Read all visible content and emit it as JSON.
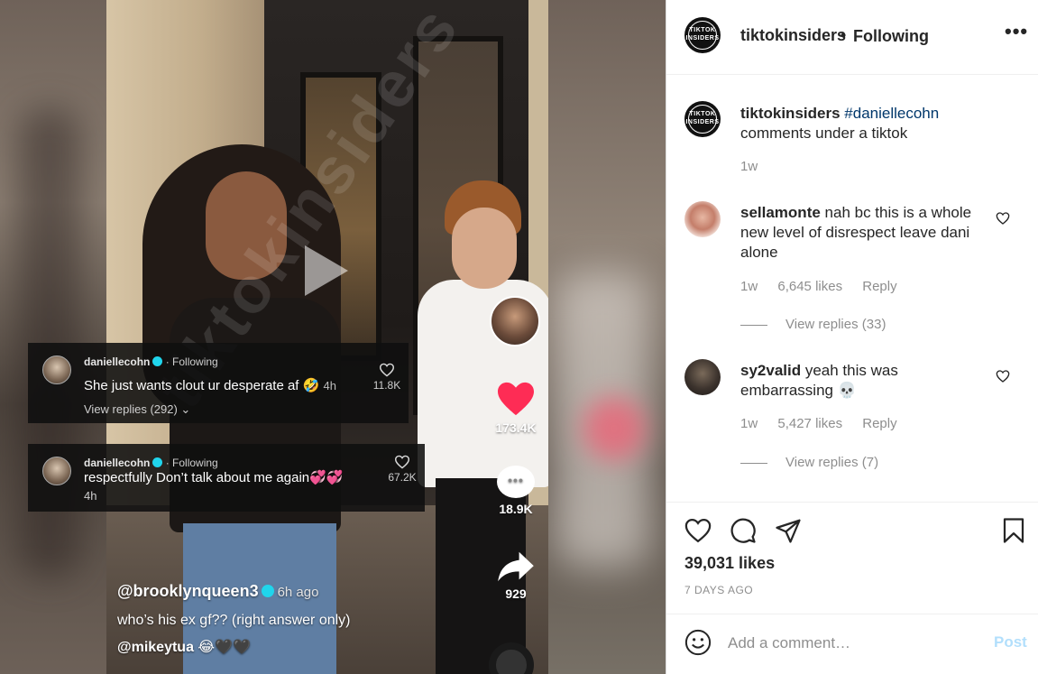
{
  "post": {
    "username": "tiktokinsiders",
    "follow_status": "Following",
    "avatar_text": "TIKTOK INSIDERS",
    "caption_username": "tiktokinsiders",
    "caption_hashtag": "#daniellecohn",
    "caption_text": "comments under a tiktok",
    "caption_age": "1w",
    "likes": "39,031 likes",
    "date": "7 DAYS AGO"
  },
  "comments": [
    {
      "username": "sellamonte",
      "text": "nah bc this is a whole new level of disrespect leave dani alone",
      "age": "1w",
      "likes": "6,645 likes",
      "reply_label": "Reply",
      "view_replies": "View replies (33)"
    },
    {
      "username": "sy2valid",
      "text": "yeah this was embarrassing 💀",
      "age": "1w",
      "likes": "5,427 likes",
      "reply_label": "Reply",
      "view_replies": "View replies (7)"
    }
  ],
  "add_comment": {
    "placeholder": "Add a comment…",
    "post_label": "Post"
  },
  "video": {
    "watermark": "tiktokinsiders",
    "overlay_comments": [
      {
        "username": "daniellecohn",
        "follow": "· Following",
        "text": "She just wants clout ur desperate af 🤣",
        "time": "4h",
        "likes": "11.8K",
        "replies": "View replies (292) ⌄"
      },
      {
        "username": "daniellecohn",
        "follow": "· Following",
        "text": "respectfully Don’t talk about me again💞💞",
        "time": "4h",
        "likes": "67.2K"
      }
    ],
    "tiktok_likes": "173.4K",
    "tiktok_comments": "18.9K",
    "tiktok_shares": "929",
    "caption_user": "@brooklynqueen3",
    "caption_ago": "6h ago",
    "caption_line1": "who’s his ex gf?? (right answer only)",
    "caption_line2": "@mikeytua 😂🖤🖤"
  },
  "colors": {
    "link": "#00376b",
    "muted": "#8e8e8e",
    "post_disabled": "#b2dffc",
    "tiktok_heart": "#fe2c55"
  }
}
